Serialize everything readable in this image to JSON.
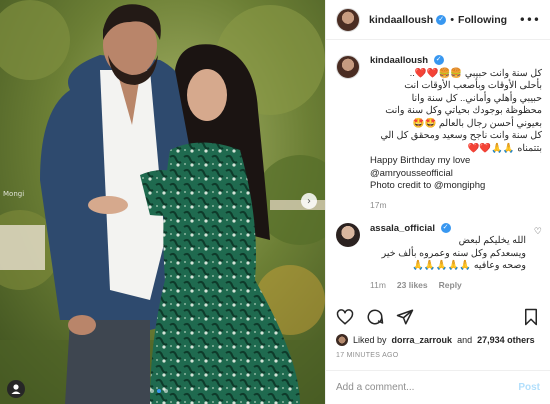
{
  "header": {
    "username": "kindaalloush",
    "separator": "•",
    "follow_label": "Following",
    "more_icon": "more-horizontal-icon"
  },
  "photo": {
    "watermark": "Mongi",
    "dots": 3,
    "active_dot": 1
  },
  "caption": {
    "username": "kindaalloush",
    "lines": [
      "كل سنة وانت حبيبي 🍔🍔❤️❤️..",
      "بأحلى الأوقات وبأصعب الأوقات انت",
      "حبيبي وأهلي وأماني.. كل سنة وانا",
      "محظوظة بوجودك بحياتي وكل سنة وانت",
      "بعيوني أحسن رجال بالعالم 🤩🤩",
      "كل سنة وانت ناجح وسعيد ومحقق كل الي",
      "بتتمناه 🙏🙏❤️❤️"
    ],
    "en_lines": [
      "Happy Birthday my love",
      "@amryousseofficial",
      "Photo credit to @mongiphg"
    ],
    "age": "17m"
  },
  "comment": {
    "username": "assala_official",
    "lines": [
      "الله يخليكم لبعض",
      "ويسعدكم وكل سنه وعمروه بألف خير",
      "وصحه وعافيه 🙏🙏🙏🙏🙏"
    ],
    "age": "11m",
    "likes": "23 likes",
    "reply": "Reply"
  },
  "likes": {
    "prefix": "Liked by",
    "user": "dorra_zarrouk",
    "and": "and",
    "others": "27,934 others"
  },
  "timestamp": "17 MINUTES AGO",
  "add_comment": {
    "placeholder": "Add a comment...",
    "post_label": "Post"
  },
  "colors": {
    "verified": "#3897f0",
    "post_disabled": "#b2dffc",
    "muted": "#8e8e8e"
  }
}
